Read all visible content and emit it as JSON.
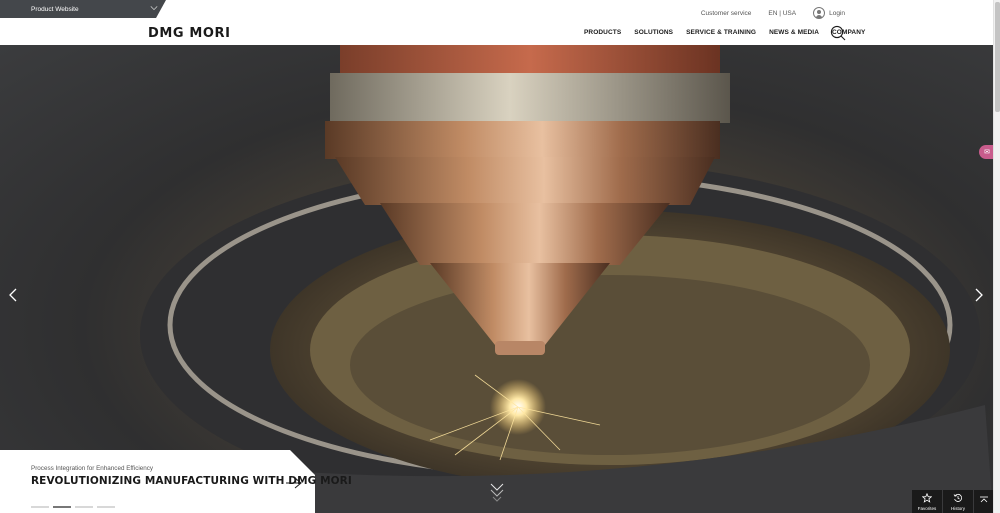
{
  "topbar": {
    "product_switch_label": "Product Website",
    "customer_service": "Customer service",
    "language": "EN | USA",
    "login": "Login"
  },
  "header": {
    "logo": "DMG MORI",
    "nav": [
      "PRODUCTS",
      "SOLUTIONS",
      "SERVICE & TRAINING",
      "NEWS & MEDIA",
      "COMPANY"
    ]
  },
  "hero": {
    "subtitle": "Process Integration for Enhanced Efficiency",
    "title": "REVOLUTIONIZING MANUFACTURING WITH DMG MORI",
    "slide_count": 4,
    "active_slide": 2
  },
  "tools": {
    "favorites": "Favorites",
    "history": "History"
  },
  "icons": [
    "chevron-down-icon",
    "user-icon",
    "search-icon",
    "chevron-left-icon",
    "chevron-right-icon",
    "arrow-right-icon",
    "scroll-down-icon",
    "star-icon",
    "history-icon",
    "back-to-top-icon"
  ],
  "colors": {
    "topbar_dark": "#44474b",
    "text_dark": "#1a1a1a",
    "accent_pill": "#c85c8c"
  }
}
